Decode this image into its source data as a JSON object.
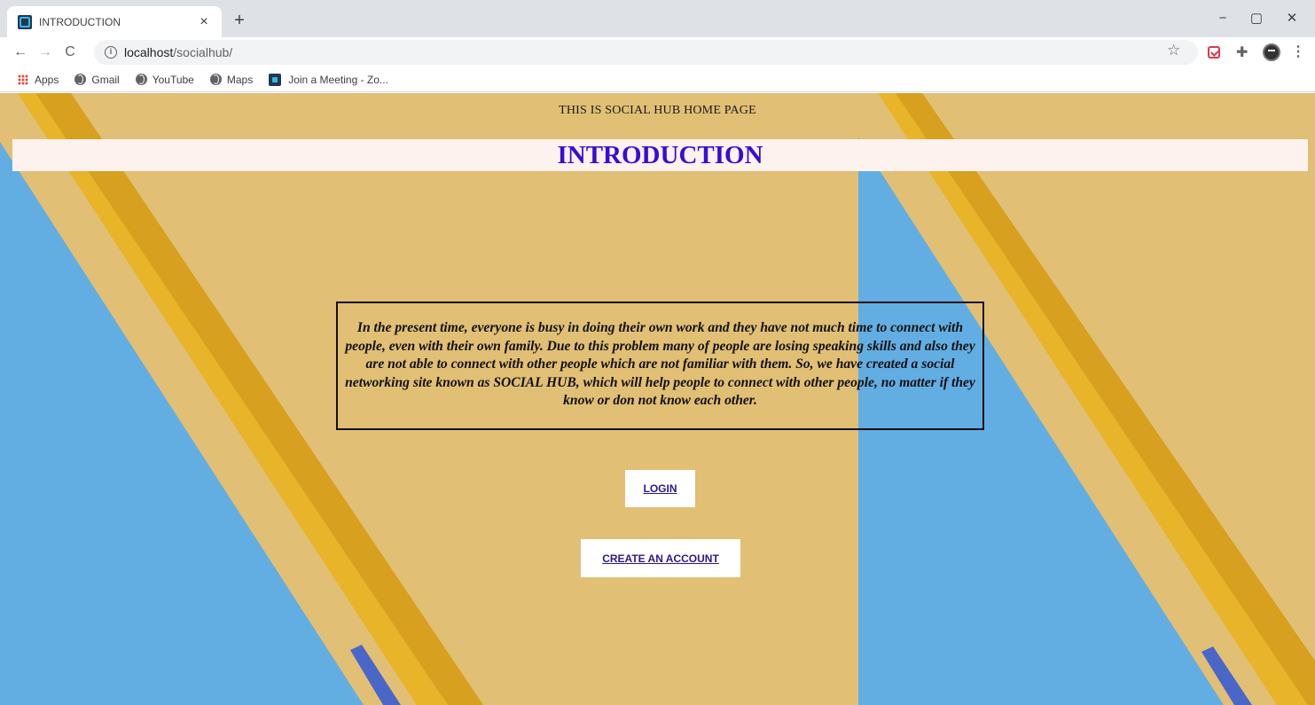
{
  "browser": {
    "tab": {
      "title": "INTRODUCTION",
      "close": "×"
    },
    "new_tab": "+",
    "window_controls": {
      "minimize": "−",
      "maximize": "▢",
      "close": "✕"
    },
    "nav": {
      "back": "←",
      "forward": "→",
      "reload": "C"
    },
    "address": {
      "host": "localhost",
      "path": "/socialhub/"
    },
    "bookmarks": [
      {
        "label": "Apps",
        "icon": "apps-grid-icon"
      },
      {
        "label": "Gmail",
        "icon": "globe-icon"
      },
      {
        "label": "YouTube",
        "icon": "globe-icon"
      },
      {
        "label": "Maps",
        "icon": "globe-icon"
      },
      {
        "label": "Join a Meeting - Zo...",
        "icon": "zoom-icon"
      }
    ]
  },
  "page": {
    "header_line": "THIS IS SOCIAL HUB HOME PAGE",
    "title": "INTRODUCTION",
    "intro": "In the present time, everyone is busy in doing their own work and they have not much time to connect with people, even with their own family. Due to this problem many of people are losing speaking skills and also they are not able to connect with other people which are not familiar with them. So, we have created a social networking site known as SOCIAL HUB, which will help people to connect with other people, no matter if they know or don not know each other.",
    "login_label": "LOGIN",
    "create_label": "CREATE AN ACCOUNT"
  },
  "colors": {
    "title_text": "#3b0bd6",
    "title_bar": "#fdf2ee",
    "background_paper": "#e4c177",
    "background_blue": "#62aee3",
    "pencil": "#e8b42a"
  }
}
